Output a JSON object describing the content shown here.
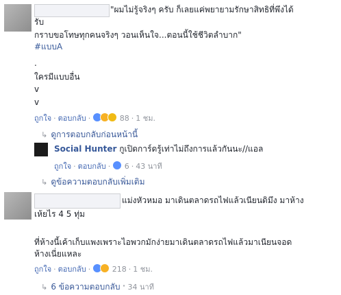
{
  "comments": [
    {
      "text_lines": [
        "\"ผมไม่รู้จริงๆ ครับ ก็เลยแค่พยายามรักษาสิทธิที่พึงได้",
        "รับ",
        "กราบขอโทษทุกคนจริงๆ วอนเห็นใจ...ตอนนี้ใช้ชีวิตลำบาก\"",
        "#แบบA",
        ".",
        "ใครมีแบบอื่น",
        "v",
        "v"
      ],
      "actions": {
        "like": "ถูกใจ",
        "reply": "ตอบกลับ",
        "reaction_count": "88",
        "time": "1 ชม."
      },
      "previous_replies": "ดูการตอบกลับก่อนหน้านี้",
      "reply": {
        "author": "Social Hunter",
        "text": "กูเปิดการ์ดรู้เท่าไม่ถึงการแล้วกันนะ//แอล",
        "actions": {
          "like": "ถูกใจ",
          "reply": "ตอบกลับ",
          "reaction_count": "6",
          "time": "43 นาที"
        }
      },
      "more_replies": "ดูข้อความตอบกลับเพิ่มเติม"
    },
    {
      "text_lines": [
        "แม่งหัวหมอ มาเดินตลาดรถไฟแล้วเนียนดิมึง มาห้าง",
        "เห้ยไร 4 5 ทุ่ม",
        "ที่ห้างนี้เค้าเก็บแพงเพราะไอพวกมักง่ายมาเดินตลาดรถไฟแล้วมาเนียนจอด",
        "ห้างเนี่ยแหละ"
      ],
      "actions": {
        "like": "ถูกใจ",
        "reply": "ตอบกลับ",
        "reaction_count": "218",
        "time": "1 ชม."
      },
      "replies_summary": "6 ข้อความตอบกลับ",
      "replies_time": "34 นาที"
    }
  ]
}
